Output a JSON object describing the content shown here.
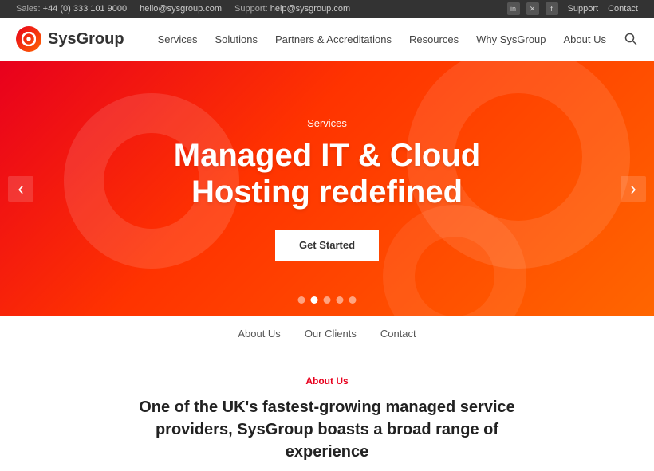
{
  "topbar": {
    "sales_label": "Sales:",
    "sales_phone": "+44 (0) 333 101 9000",
    "hello_email": "hello@sysgroup.com",
    "support_label": "Support:",
    "support_email": "help@sysgroup.com",
    "social": [
      "in",
      "tw",
      "f"
    ],
    "links": [
      "Support",
      "Contact"
    ]
  },
  "nav": {
    "logo_text": "SysGroup",
    "links": [
      "Services",
      "Solutions",
      "Partners & Accreditations",
      "Resources",
      "Why SysGroup",
      "About Us"
    ]
  },
  "hero": {
    "subtitle": "Services",
    "title": "Managed IT & Cloud\nHosting redefined",
    "cta_label": "Get Started",
    "dots": [
      1,
      2,
      3,
      4,
      5
    ],
    "active_dot": 1
  },
  "sub_nav": {
    "links": [
      "About Us",
      "Our Clients",
      "Contact"
    ]
  },
  "about": {
    "label": "About Us",
    "text": "One of the UK's fastest-growing managed service providers, SysGroup boasts a broad range of experience"
  }
}
